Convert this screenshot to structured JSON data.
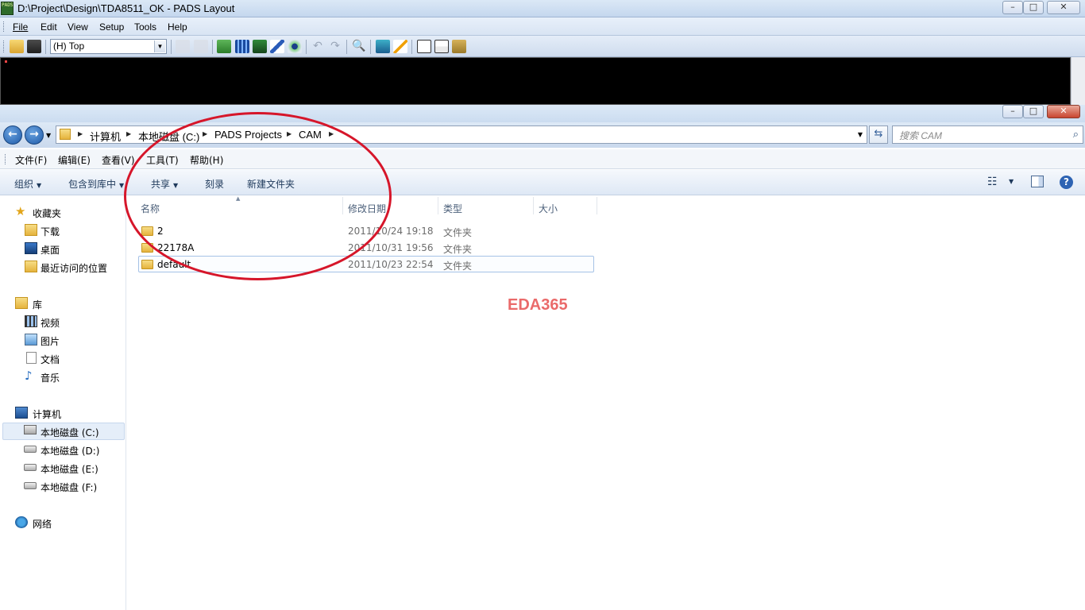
{
  "pads": {
    "window_title": "D:\\Project\\Design\\TDA8511_OK - PADS Layout",
    "logo_text": "PADS",
    "menu": [
      {
        "label": "File",
        "hotkey_index": 0
      },
      {
        "label": "Edit",
        "hotkey_index": 0
      },
      {
        "label": "View",
        "hotkey_index": 0
      },
      {
        "label": "Setup",
        "hotkey_index": 0
      },
      {
        "label": "Tools",
        "hotkey_index": 0
      },
      {
        "label": "Help",
        "hotkey_index": 0
      }
    ],
    "layer_select_value": "(H) Top",
    "window_buttons": {
      "minimize": "–",
      "maximize": "□",
      "close": "✕"
    }
  },
  "explorer": {
    "window_buttons": {
      "minimize": "–",
      "maximize": "□",
      "close": "✕"
    },
    "nav": {
      "back": "←",
      "forward": "→"
    },
    "breadcrumb": [
      "计算机",
      "本地磁盘 (C:)",
      "PADS Projects",
      "CAM"
    ],
    "search_placeholder": "搜索 CAM",
    "menu": [
      "文件(F)",
      "编辑(E)",
      "查看(V)",
      "工具(T)",
      "帮助(H)"
    ],
    "commands": {
      "organize": "组织",
      "include_library": "包含到库中",
      "share": "共享",
      "burn": "刻录",
      "new_folder": "新建文件夹"
    },
    "sidebar": {
      "favorites_header": "收藏夹",
      "favorites": [
        "下载",
        "桌面",
        "最近访问的位置"
      ],
      "libraries_header": "库",
      "libraries": [
        "视频",
        "图片",
        "文档",
        "音乐"
      ],
      "computer_header": "计算机",
      "drives": [
        "本地磁盘 (C:)",
        "本地磁盘 (D:)",
        "本地磁盘 (E:)",
        "本地磁盘 (F:)"
      ],
      "network_header": "网络"
    },
    "columns": [
      "名称",
      "修改日期",
      "类型",
      "大小"
    ],
    "files": [
      {
        "name": "2",
        "modified": "2011/10/24 19:18",
        "type": "文件夹"
      },
      {
        "name": "22178A",
        "modified": "2011/10/31 19:56",
        "type": "文件夹"
      },
      {
        "name": "default",
        "modified": "2011/10/23 22:54",
        "type": "文件夹"
      }
    ]
  },
  "watermark": "EDA365",
  "colors": {
    "annotation_circle": "#d6162a",
    "watermark": "#ea6a6a",
    "canvas": "#000000"
  }
}
